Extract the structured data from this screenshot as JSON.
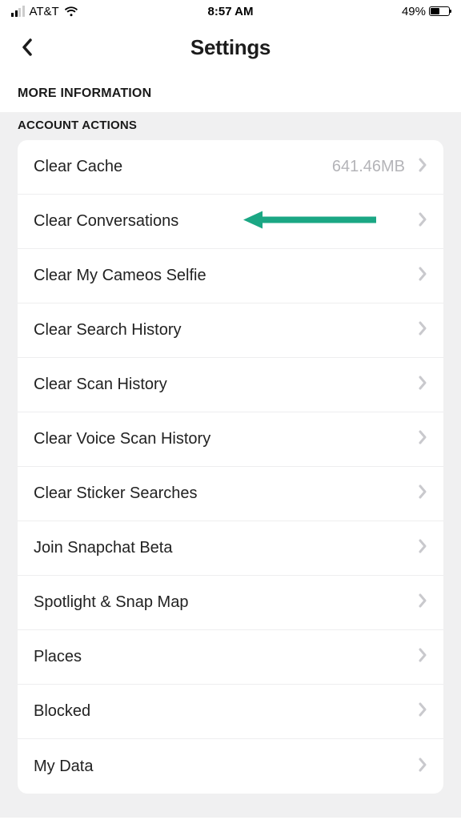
{
  "status": {
    "carrier": "AT&T",
    "time": "8:57 AM",
    "battery_pct": "49%"
  },
  "header": {
    "title": "Settings"
  },
  "sections": {
    "more_info_label": "MORE INFORMATION",
    "account_actions_label": "ACCOUNT ACTIONS"
  },
  "rows": {
    "clear_cache": {
      "label": "Clear Cache",
      "value": "641.46MB"
    },
    "clear_conversations": {
      "label": "Clear Conversations"
    },
    "clear_cameos": {
      "label": "Clear My Cameos Selfie"
    },
    "clear_search": {
      "label": "Clear Search History"
    },
    "clear_scan": {
      "label": "Clear Scan History"
    },
    "clear_voice_scan": {
      "label": "Clear Voice Scan History"
    },
    "clear_sticker": {
      "label": "Clear Sticker Searches"
    },
    "join_beta": {
      "label": "Join Snapchat Beta"
    },
    "spotlight": {
      "label": "Spotlight & Snap Map"
    },
    "places": {
      "label": "Places"
    },
    "blocked": {
      "label": "Blocked"
    },
    "mydata": {
      "label": "My Data"
    }
  },
  "annotation": {
    "arrow_color": "#1ba784"
  }
}
